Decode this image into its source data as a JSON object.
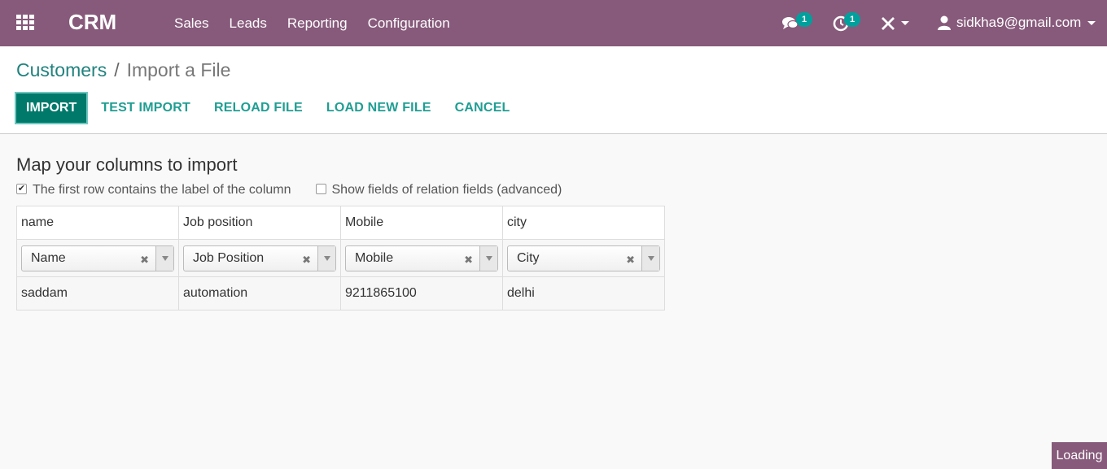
{
  "navbar": {
    "brand": "CRM",
    "menu": [
      "Sales",
      "Leads",
      "Reporting",
      "Configuration"
    ],
    "messages_count": "1",
    "activities_count": "1",
    "user": "sidkha9@gmail.com"
  },
  "breadcrumb": {
    "parent": "Customers",
    "separator": "/",
    "current": "Import a File"
  },
  "actions": {
    "import": "IMPORT",
    "test_import": "TEST IMPORT",
    "reload_file": "RELOAD FILE",
    "load_new_file": "LOAD NEW FILE",
    "cancel": "CANCEL"
  },
  "main": {
    "heading": "Map your columns to import",
    "first_row_label": "The first row contains the label of the column",
    "first_row_checked": true,
    "show_relation_label": "Show fields of relation fields (advanced)",
    "show_relation_checked": false
  },
  "table": {
    "headers": [
      "name",
      "Job position",
      "Mobile",
      "city"
    ],
    "mappings": [
      "Name",
      "Job Position",
      "Mobile",
      "City"
    ],
    "rows": [
      [
        "saddam",
        "automation",
        "9211865100",
        "delhi"
      ]
    ]
  },
  "status": {
    "loading": "Loading"
  },
  "colors": {
    "navbar": "#875a7b",
    "primary": "#00796b",
    "link": "#1f9e93",
    "badge": "#00a09d"
  }
}
